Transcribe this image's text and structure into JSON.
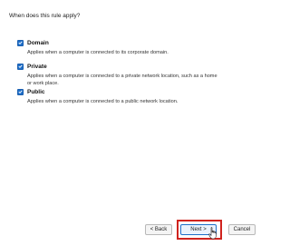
{
  "question": "When does this rule apply?",
  "options": [
    {
      "label": "Domain",
      "description": "Applies when a computer is connected to its corporate domain.",
      "checked": true
    },
    {
      "label": "Private",
      "description": "Applies when a computer is connected to a private network location, such as a home or work place.",
      "checked": true
    },
    {
      "label": "Public",
      "description": "Applies when a computer is connected to a public network location.",
      "checked": true
    }
  ],
  "buttons": {
    "back": "< Back",
    "next": "Next >",
    "cancel": "Cancel"
  },
  "colors": {
    "checkbox": "#1f6fc9",
    "highlight": "#d0231e"
  },
  "icons": {
    "checkbox_mark": "checkmark-icon",
    "pointer": "hand-pointer-icon"
  }
}
